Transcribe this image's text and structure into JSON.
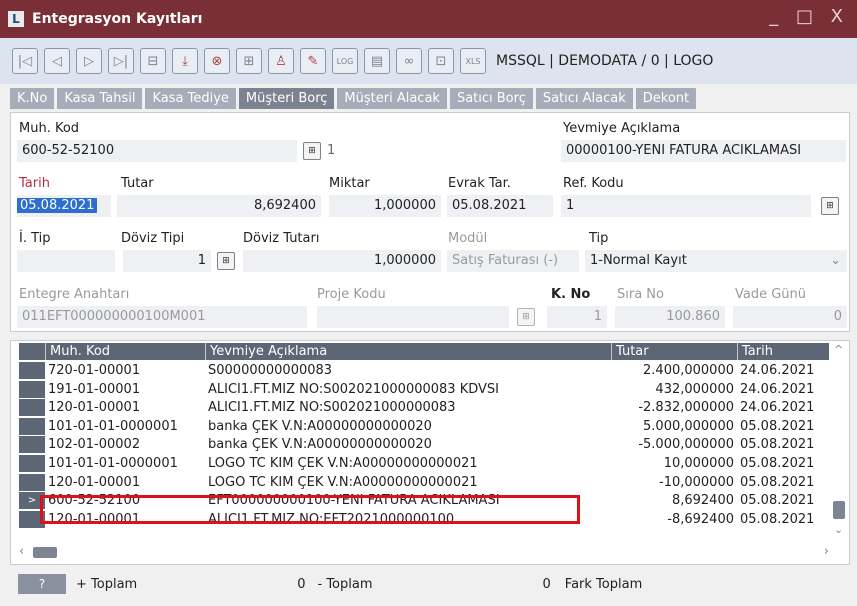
{
  "window": {
    "title": "Entegrasyon Kayıtları",
    "app_icon": "L",
    "controls": "_ □ X"
  },
  "toolbar": {
    "icons": [
      "first-icon",
      "prev-icon",
      "next-icon",
      "last-icon",
      "minus-icon",
      "download-icon",
      "cancel-icon",
      "add-icon",
      "user-icon",
      "edit-icon",
      "log-icon",
      "doc-icon",
      "link-icon",
      "lock-icon",
      "excel-icon"
    ],
    "connection": "MSSQL | DEMODATA / 0 | LOGO"
  },
  "tabs": [
    "K.No",
    "Kasa Tahsil",
    "Kasa Tediye",
    "Müşteri Borç",
    "Müşteri Alacak",
    "Satıcı Borç",
    "Satıcı Alacak",
    "Dekont"
  ],
  "active_tab": "Müşteri Borç",
  "form": {
    "muh_kod_label": "Muh. Kod",
    "muh_kod": "600-52-52100",
    "muh_kod_count": "1",
    "yevmiye_label": "Yevmiye Açıklama",
    "yevmiye": "00000100-YENI FATURA ACIKLAMASI",
    "tarih_label": "Tarih",
    "tarih": "05.08.2021",
    "tutar_label": "Tutar",
    "tutar": "8,692400",
    "miktar_label": "Miktar",
    "miktar": "1,000000",
    "evrak_tar_label": "Evrak Tar.",
    "evrak_tar": "05.08.2021",
    "ref_kodu_label": "Ref. Kodu",
    "ref_kodu": "1",
    "i_tip_label": "İ. Tip",
    "i_tip": "",
    "doviz_tipi_label": "Döviz Tipi",
    "doviz_tipi": "1",
    "doviz_tutari_label": "Döviz Tutarı",
    "doviz_tutari": "1,000000",
    "modul_label": "Modül",
    "modul": "Satış Faturası (-)",
    "tip_label": "Tip",
    "tip": "1-Normal Kayıt",
    "entegre_label": "Entegre Anahtarı",
    "entegre": "011EFT000000000100M001",
    "proje_label": "Proje Kodu",
    "proje": "",
    "k_no_label": "K. No",
    "k_no": "1",
    "sira_no_label": "Sıra No",
    "sira_no": "100.860",
    "vade_label": "Vade Günü",
    "vade": "0"
  },
  "grid": {
    "columns": [
      "Muh. Kod",
      "Yevmiye Açıklama",
      "Tutar",
      "Tarih"
    ],
    "rows": [
      [
        "720-01-00001",
        "S00000000000083",
        "2.400,000000",
        "24.06.2021"
      ],
      [
        "191-01-00001",
        "ALICI1.FT.MIZ NO:S002021000000083 KDVSI",
        "432,000000",
        "24.06.2021"
      ],
      [
        "120-01-00001",
        "ALICI1.FT.MIZ NO:S002021000000083",
        "-2.832,000000",
        "24.06.2021"
      ],
      [
        "101-01-01-0000001",
        "banka ÇEK V.N:A00000000000020",
        "5.000,000000",
        "05.08.2021"
      ],
      [
        "102-01-00002",
        "banka ÇEK V.N:A00000000000020",
        "-5.000,000000",
        "05.08.2021"
      ],
      [
        "101-01-01-0000001",
        "LOGO TC KIM ÇEK V.N:A00000000000021",
        "10,000000",
        "05.08.2021"
      ],
      [
        "120-01-00001",
        "LOGO TC KIM ÇEK V.N:A00000000000021",
        "-10,000000",
        "05.08.2021"
      ],
      [
        "600-52-52100",
        "EFT000000000100-YENI FATURA ACIKLAMASI",
        "8,692400",
        "05.08.2021"
      ],
      [
        "120-01-00001",
        "ALICI1.FT.MIZ NO:EFT2021000000100",
        "-8,692400",
        "05.08.2021"
      ]
    ],
    "current_row_marker": ">"
  },
  "footer": {
    "help": "?",
    "plus_label": "+ Toplam",
    "plus_value": "0",
    "minus_label": "- Toplam",
    "minus_value": "0",
    "fark_label": "Fark Toplam"
  },
  "colors": {
    "titlebar": "#7a2e35",
    "highlight": "#e0101a",
    "header": "#5d6674"
  }
}
